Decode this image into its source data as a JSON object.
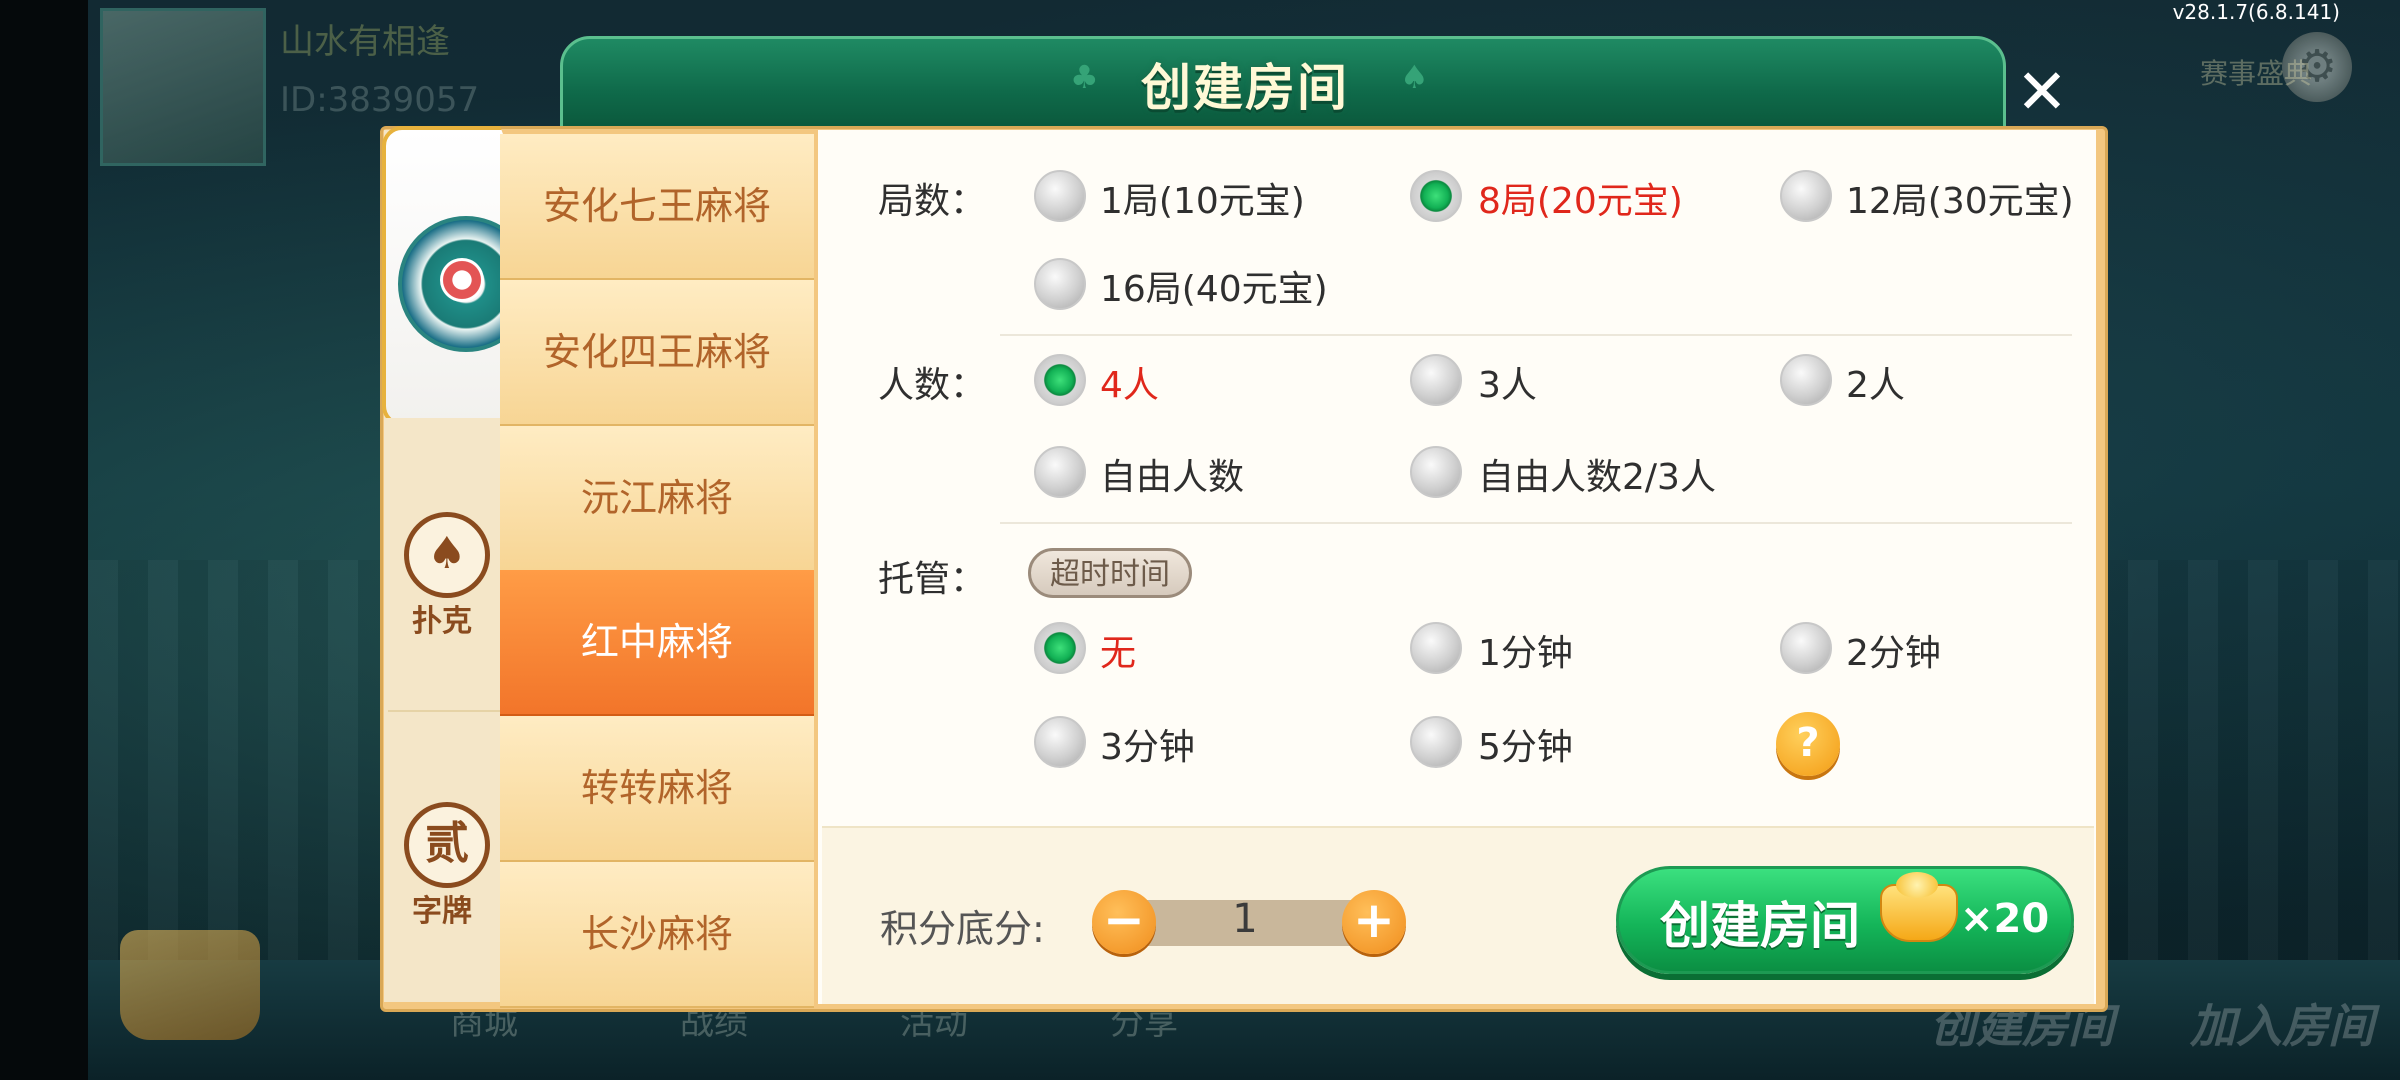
{
  "version": "v28.1.7(6.8.141)",
  "background": {
    "nickname": "山水有相逢",
    "user_id": "ID:3839057",
    "bottom_nav": [
      "商城",
      "战绩",
      "活动",
      "分享"
    ],
    "bottom_actions": [
      "创建房间",
      "加入房间"
    ],
    "top_right_text": "赛事盛典"
  },
  "dialog": {
    "title": "创建房间",
    "close_icon": "close-icon",
    "categories": [
      {
        "label": "",
        "icon": "mahjong-icon",
        "active": true
      },
      {
        "label": "扑克",
        "icon": "spade-icon",
        "glyph": "♠"
      },
      {
        "label": "字牌",
        "icon": "zipai-icon",
        "glyph": "贰"
      }
    ],
    "games": [
      {
        "label": "安化七王麻将"
      },
      {
        "label": "安化四王麻将"
      },
      {
        "label": "沅江麻将"
      },
      {
        "label": "红中麻将",
        "active": true
      },
      {
        "label": "转转麻将"
      },
      {
        "label": "长沙麻将"
      }
    ],
    "rounds": {
      "label": "局数：",
      "options": [
        "1局(10元宝)",
        "8局(20元宝)",
        "12局(30元宝)",
        "16局(40元宝)"
      ],
      "selected": "8局(20元宝)"
    },
    "players": {
      "label": "人数：",
      "options": [
        "4人",
        "3人",
        "2人",
        "自由人数",
        "自由人数2/3人"
      ],
      "selected": "4人"
    },
    "auto": {
      "label": "托管：",
      "badge": "超时时间",
      "options": [
        "无",
        "1分钟",
        "2分钟",
        "3分钟",
        "5分钟"
      ],
      "selected": "无",
      "help": "?"
    },
    "score": {
      "label": "积分底分:",
      "value": "1",
      "minus": "−",
      "plus": "+"
    },
    "create": {
      "label": "创建房间",
      "cost": "×20"
    },
    "colors": {
      "header_green": "#0f6a4a",
      "selected_red": "#e0271b",
      "active_orange": "#f2752a",
      "button_green": "#14b559"
    }
  }
}
